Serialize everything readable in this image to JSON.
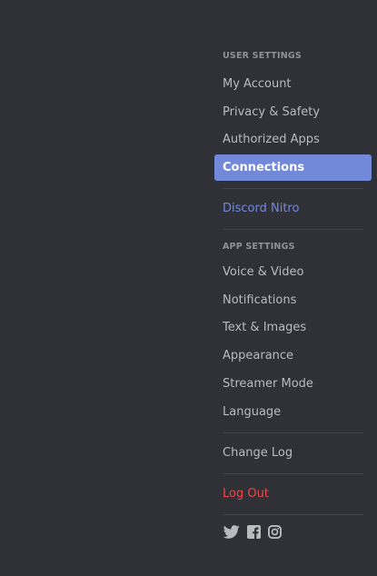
{
  "user_settings": {
    "header": "USER SETTINGS",
    "items": [
      {
        "label": "My Account"
      },
      {
        "label": "Privacy & Safety"
      },
      {
        "label": "Authorized Apps"
      },
      {
        "label": "Connections",
        "selected": true
      }
    ]
  },
  "nitro": {
    "label": "Discord Nitro"
  },
  "app_settings": {
    "header": "APP SETTINGS",
    "items": [
      {
        "label": "Voice & Video"
      },
      {
        "label": "Notifications"
      },
      {
        "label": "Text & Images"
      },
      {
        "label": "Appearance"
      },
      {
        "label": "Streamer Mode"
      },
      {
        "label": "Language"
      }
    ]
  },
  "change_log": {
    "label": "Change Log"
  },
  "log_out": {
    "label": "Log Out"
  },
  "social_icons": [
    "twitter-icon",
    "facebook-icon",
    "instagram-icon"
  ],
  "colors": {
    "background": "#2f3136",
    "selected": "#7289da",
    "danger": "#f04747",
    "text": "#b9bbbe"
  }
}
